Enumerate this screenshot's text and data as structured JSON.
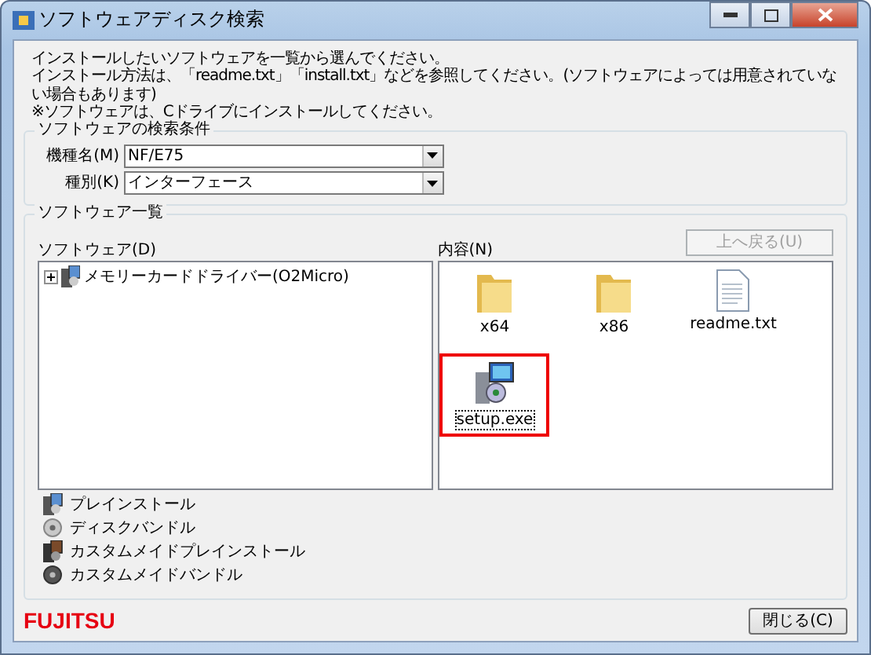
{
  "window": {
    "title": "ソフトウェアディスク検索"
  },
  "instructions": [
    "インストールしたいソフトウェアを一覧から選んでください。",
    "インストール方法は、「readme.txt」「install.txt」などを参照してください。(ソフトウェアによっては用意されていない場合もあります)",
    "※ソフトウェアは、Cドライブにインストールしてください。"
  ],
  "search_conditions": {
    "title": "ソフトウェアの検索条件",
    "fields": [
      {
        "label": "機種名(M)",
        "value": "NF/E75"
      },
      {
        "label": "種別(K)",
        "value": "インターフェース"
      }
    ]
  },
  "software_list": {
    "title": "ソフトウェア一覧",
    "tree_label": "ソフトウェア(D)",
    "tree": [
      {
        "label": "メモリーカードドライバー(O2Micro)",
        "kind": "preinstall",
        "expanded": false
      }
    ]
  },
  "contents": {
    "label": "内容(N)",
    "up_button": {
      "label": "上へ戻る(U)",
      "disabled": true
    },
    "items": [
      {
        "name": "x64",
        "kind": "folder",
        "selected": false
      },
      {
        "name": "x86",
        "kind": "folder",
        "selected": false
      },
      {
        "name": "readme.txt",
        "kind": "text",
        "selected": false
      },
      {
        "name": "setup.exe",
        "kind": "installer",
        "selected": true
      }
    ]
  },
  "legend": [
    {
      "kind": "preinstall",
      "label": "プレインストール"
    },
    {
      "kind": "disc",
      "label": "ディスクバンドル"
    },
    {
      "kind": "custom_preinstall",
      "label": "カスタムメイドプレインストール"
    },
    {
      "kind": "custom_disc",
      "label": "カスタムメイドバンドル"
    }
  ],
  "footer": {
    "logo": "FUJITSU",
    "close_button": "閉じる(C)"
  }
}
